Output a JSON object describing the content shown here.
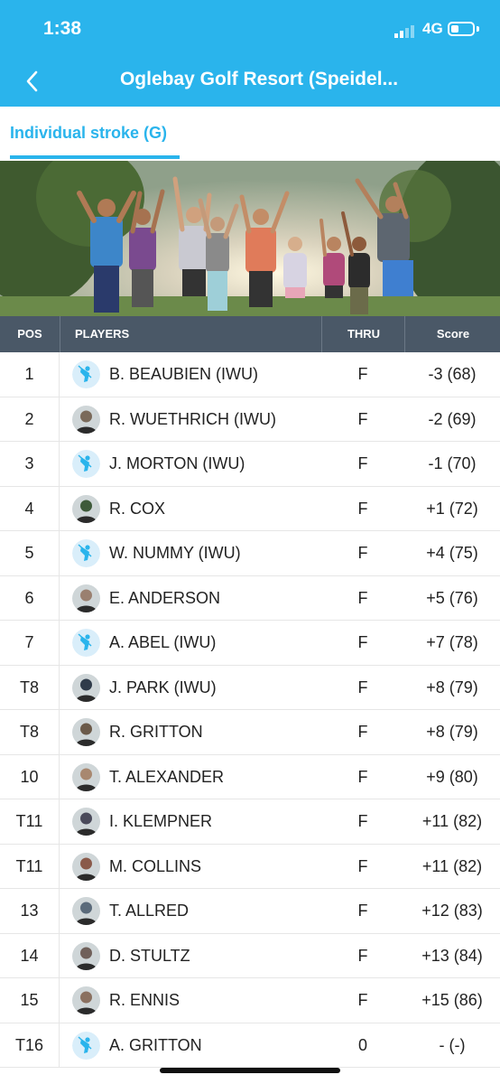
{
  "status_bar": {
    "time": "1:38",
    "network": "4G",
    "battery_level": 0.35
  },
  "nav": {
    "back_icon": "chevron-left-icon",
    "title": "Oglebay Golf Resort (Speidel..."
  },
  "tabs": [
    {
      "label": "Individual stroke (G)",
      "active": true
    }
  ],
  "table": {
    "headers": {
      "pos": "POS",
      "players": "PLAYERS",
      "thru": "THRU",
      "score": "Score"
    },
    "rows": [
      {
        "pos": "1",
        "name": "B. BEAUBIEN (IWU)",
        "thru": "F",
        "score": "-3 (68)",
        "avatar": "default-golfer-icon"
      },
      {
        "pos": "2",
        "name": "R. WUETHRICH (IWU)",
        "thru": "F",
        "score": "-2 (69)",
        "avatar": "photo"
      },
      {
        "pos": "3",
        "name": "J. MORTON (IWU)",
        "thru": "F",
        "score": "-1 (70)",
        "avatar": "default-golfer-icon"
      },
      {
        "pos": "4",
        "name": "R. COX",
        "thru": "F",
        "score": "+1 (72)",
        "avatar": "photo"
      },
      {
        "pos": "5",
        "name": "W. NUMMY (IWU)",
        "thru": "F",
        "score": "+4 (75)",
        "avatar": "default-golfer-icon"
      },
      {
        "pos": "6",
        "name": "E. ANDERSON",
        "thru": "F",
        "score": "+5 (76)",
        "avatar": "photo"
      },
      {
        "pos": "7",
        "name": "A. ABEL (IWU)",
        "thru": "F",
        "score": "+7 (78)",
        "avatar": "default-golfer-icon"
      },
      {
        "pos": "T8",
        "name": "J. PARK (IWU)",
        "thru": "F",
        "score": "+8 (79)",
        "avatar": "photo"
      },
      {
        "pos": "T8",
        "name": "R. GRITTON",
        "thru": "F",
        "score": "+8 (79)",
        "avatar": "photo"
      },
      {
        "pos": "10",
        "name": "T. ALEXANDER",
        "thru": "F",
        "score": "+9 (80)",
        "avatar": "photo"
      },
      {
        "pos": "T11",
        "name": "I. KLEMPNER",
        "thru": "F",
        "score": "+11 (82)",
        "avatar": "photo"
      },
      {
        "pos": "T11",
        "name": "M. COLLINS",
        "thru": "F",
        "score": "+11 (82)",
        "avatar": "photo"
      },
      {
        "pos": "13",
        "name": "T. ALLRED",
        "thru": "F",
        "score": "+12 (83)",
        "avatar": "photo"
      },
      {
        "pos": "14",
        "name": "D. STULTZ",
        "thru": "F",
        "score": "+13 (84)",
        "avatar": "photo"
      },
      {
        "pos": "15",
        "name": "R. ENNIS",
        "thru": "F",
        "score": "+15 (86)",
        "avatar": "photo"
      },
      {
        "pos": "T16",
        "name": "A. GRITTON",
        "thru": "0",
        "score": "- (-)",
        "avatar": "default-golfer-icon"
      }
    ]
  },
  "colors": {
    "accent": "#2ab4ec",
    "header_bg": "#4a5867"
  }
}
